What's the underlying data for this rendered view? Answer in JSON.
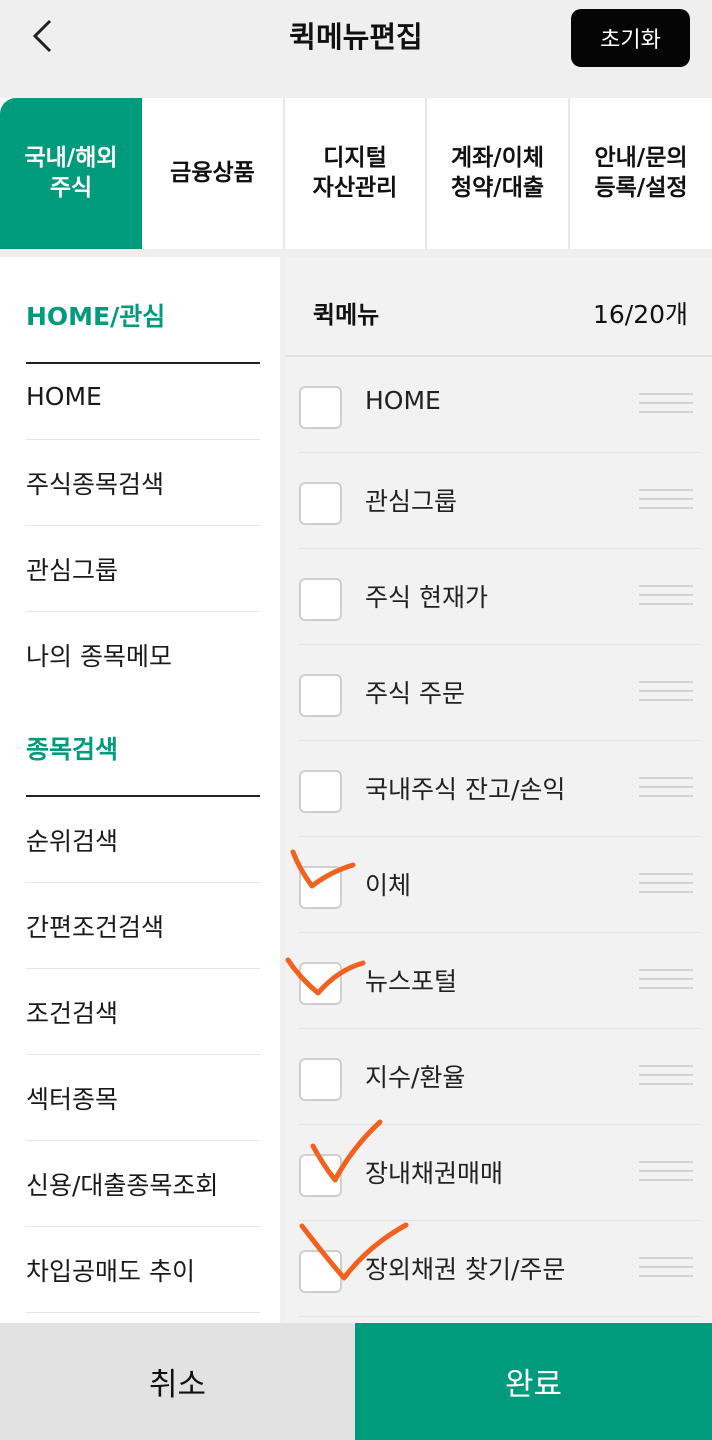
{
  "header": {
    "title": "퀵메뉴편집",
    "reset_label": "초기화",
    "back_icon": "chevron-left-icon"
  },
  "tabs": [
    {
      "line1": "국내/해외",
      "line2": "주식",
      "active": true
    },
    {
      "line1": "금융상품",
      "line2": "",
      "active": false
    },
    {
      "line1": "디지털",
      "line2": "자산관리",
      "active": false
    },
    {
      "line1": "계좌/이체",
      "line2": "청약/대출",
      "active": false
    },
    {
      "line1": "안내/문의",
      "line2": "등록/설정",
      "active": false
    }
  ],
  "left_menu": {
    "section1_title": "HOME/관심",
    "section1_items": [
      "HOME",
      "주식종목검색",
      "관심그룹",
      "나의 종목메모"
    ],
    "section2_title": "종목검색",
    "section2_items": [
      "순위검색",
      "간편조건검색",
      "조건검색",
      "섹터종목",
      "신용/대출종목조회",
      "차입공매도 추이"
    ]
  },
  "quickmenu": {
    "label": "퀵메뉴",
    "count": "16/20개",
    "items": [
      {
        "label": "HOME",
        "hand_checked": false
      },
      {
        "label": "관심그룹",
        "hand_checked": false
      },
      {
        "label": "주식 현재가",
        "hand_checked": false
      },
      {
        "label": "주식 주문",
        "hand_checked": false
      },
      {
        "label": "국내주식 잔고/손익",
        "hand_checked": false
      },
      {
        "label": "이체",
        "hand_checked": true
      },
      {
        "label": "뉴스포털",
        "hand_checked": true
      },
      {
        "label": "지수/환율",
        "hand_checked": false
      },
      {
        "label": "장내채권매매",
        "hand_checked": true
      },
      {
        "label": "장외채권 찾기/주문",
        "hand_checked": true
      }
    ]
  },
  "footer": {
    "cancel_label": "취소",
    "done_label": "완료"
  },
  "colors": {
    "accent": "#009a7c",
    "mark": "#f2611e",
    "background": "#efefef"
  }
}
